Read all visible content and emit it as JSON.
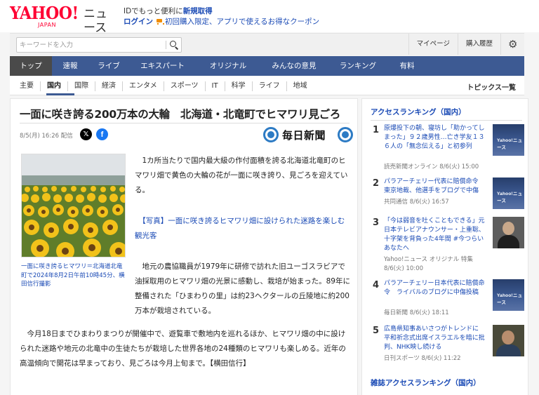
{
  "header": {
    "logo_yahoo": "YAHOO!",
    "logo_japan": "JAPAN",
    "logo_news": "ニュース",
    "promo_text": "IDでもっと便利に",
    "promo_link": "新規取得",
    "login": "ログイン",
    "coupon": "初回購入限定、アプリで使えるお得なクーポン"
  },
  "search": {
    "placeholder": "キーワードを入力",
    "value": ""
  },
  "util_links": {
    "mypage": "マイページ",
    "history": "購入履歴"
  },
  "icons": {
    "settings": "gear-icon",
    "search": "search-icon",
    "share_x": "x-icon",
    "share_facebook": "facebook-icon",
    "cart": "cart-icon"
  },
  "colors": {
    "nav_bg": "#3d5a93",
    "nav_active": "#4a4a4a",
    "link_blue": "#1a4ab5",
    "brand_red": "#ff0033"
  },
  "main_nav": [
    "トップ",
    "速報",
    "ライブ",
    "エキスパート",
    "オリジナル",
    "みんなの意見",
    "ランキング",
    "有料"
  ],
  "main_nav_active": "トップ",
  "sub_nav": [
    "主要",
    "国内",
    "国際",
    "経済",
    "エンタメ",
    "スポーツ",
    "IT",
    "科学",
    "ライフ",
    "地域"
  ],
  "sub_nav_active": "国内",
  "topics_link": "トピックス一覧",
  "article": {
    "title": "一面に咲き誇る200万本の大輪　北海道・北竜町でヒマワリ見ごろ",
    "meta": "8/5(月) 16:26 配信",
    "publisher": "毎日新聞",
    "photo_caption": "一面に咲き誇るヒマワリ＝北海道北竜町で2024年8月2日午前10時45分、横田信行撮影",
    "lead": "1カ所当たりで国内最大級の作付面積を誇る北海道北竜町のヒマワリ畑で黄色の大輪の花が一面に咲き誇り、見ごろを迎えている。",
    "photo_link": "【写真】一面に咲き誇るヒマワリ畑に設けられた迷路を楽しむ観光客",
    "p2_first": "地元の農協職員が1979年に研修で訪れた旧ユーゴスラビアで油採取用のヒマワリ畑の光景に感動し、栽培が始まった。89年に整備された「ひまわりの里」は約23ヘクタールの丘陵地に約200万本が栽培されている。",
    "p3": "今月18日までひまわりまつりが開催中で、遊覧車で敷地内を巡れるほか、ヒマワリ畑の中に設けられた迷路や地元の北竜中の生徒たちが栽培した世界各地の24種類のヒマワリも楽しめる。近年の高温傾向で開花は早まっており、見ごろは今月上旬まで。【横田信行】"
  },
  "sidebar": {
    "heading": "アクセスランキング（国内）",
    "items": [
      {
        "rank": "1",
        "title": "原爆投下の朝、寝坊し「助かってしまった」９２歳男性…亡き学友１３６人の「無念伝える」と初参列",
        "source": "読売新聞オンライン 8/6(火) 15:00",
        "thumb": "Yahoo!ニュース"
      },
      {
        "rank": "2",
        "title": "パラアーチェリー代表に賠償命令　東京地裁、他選手をブログで中傷",
        "source": "共同通信 8/6(火) 16:57",
        "thumb": "Yahoo!ニュース"
      },
      {
        "rank": "3",
        "title": "「今は弱音を吐くこともできる」元日本テレビアナウンサー・上重聡、十字架を背負った4年間 #今つらいあなたへ",
        "source": "Yahoo!ニュース オリジナル 特集",
        "source2": "8/6(火) 10:00",
        "thumb": ""
      },
      {
        "rank": "4",
        "title": "パラアーチェリー日本代表に賠償命令　ライバルのブログに中傷投稿",
        "source": "毎日新聞 8/6(火) 18:11",
        "thumb": "Yahoo!ニュース"
      },
      {
        "rank": "5",
        "title": "広島県知事あいさつがトレンドに　平和祈念式出席イスラエルを暗に批判、NHK映し続ける",
        "source": "日刊スポーツ 8/6(火) 11:22",
        "thumb": ""
      }
    ],
    "heading2": "雑誌アクセスランキング（国内）"
  }
}
